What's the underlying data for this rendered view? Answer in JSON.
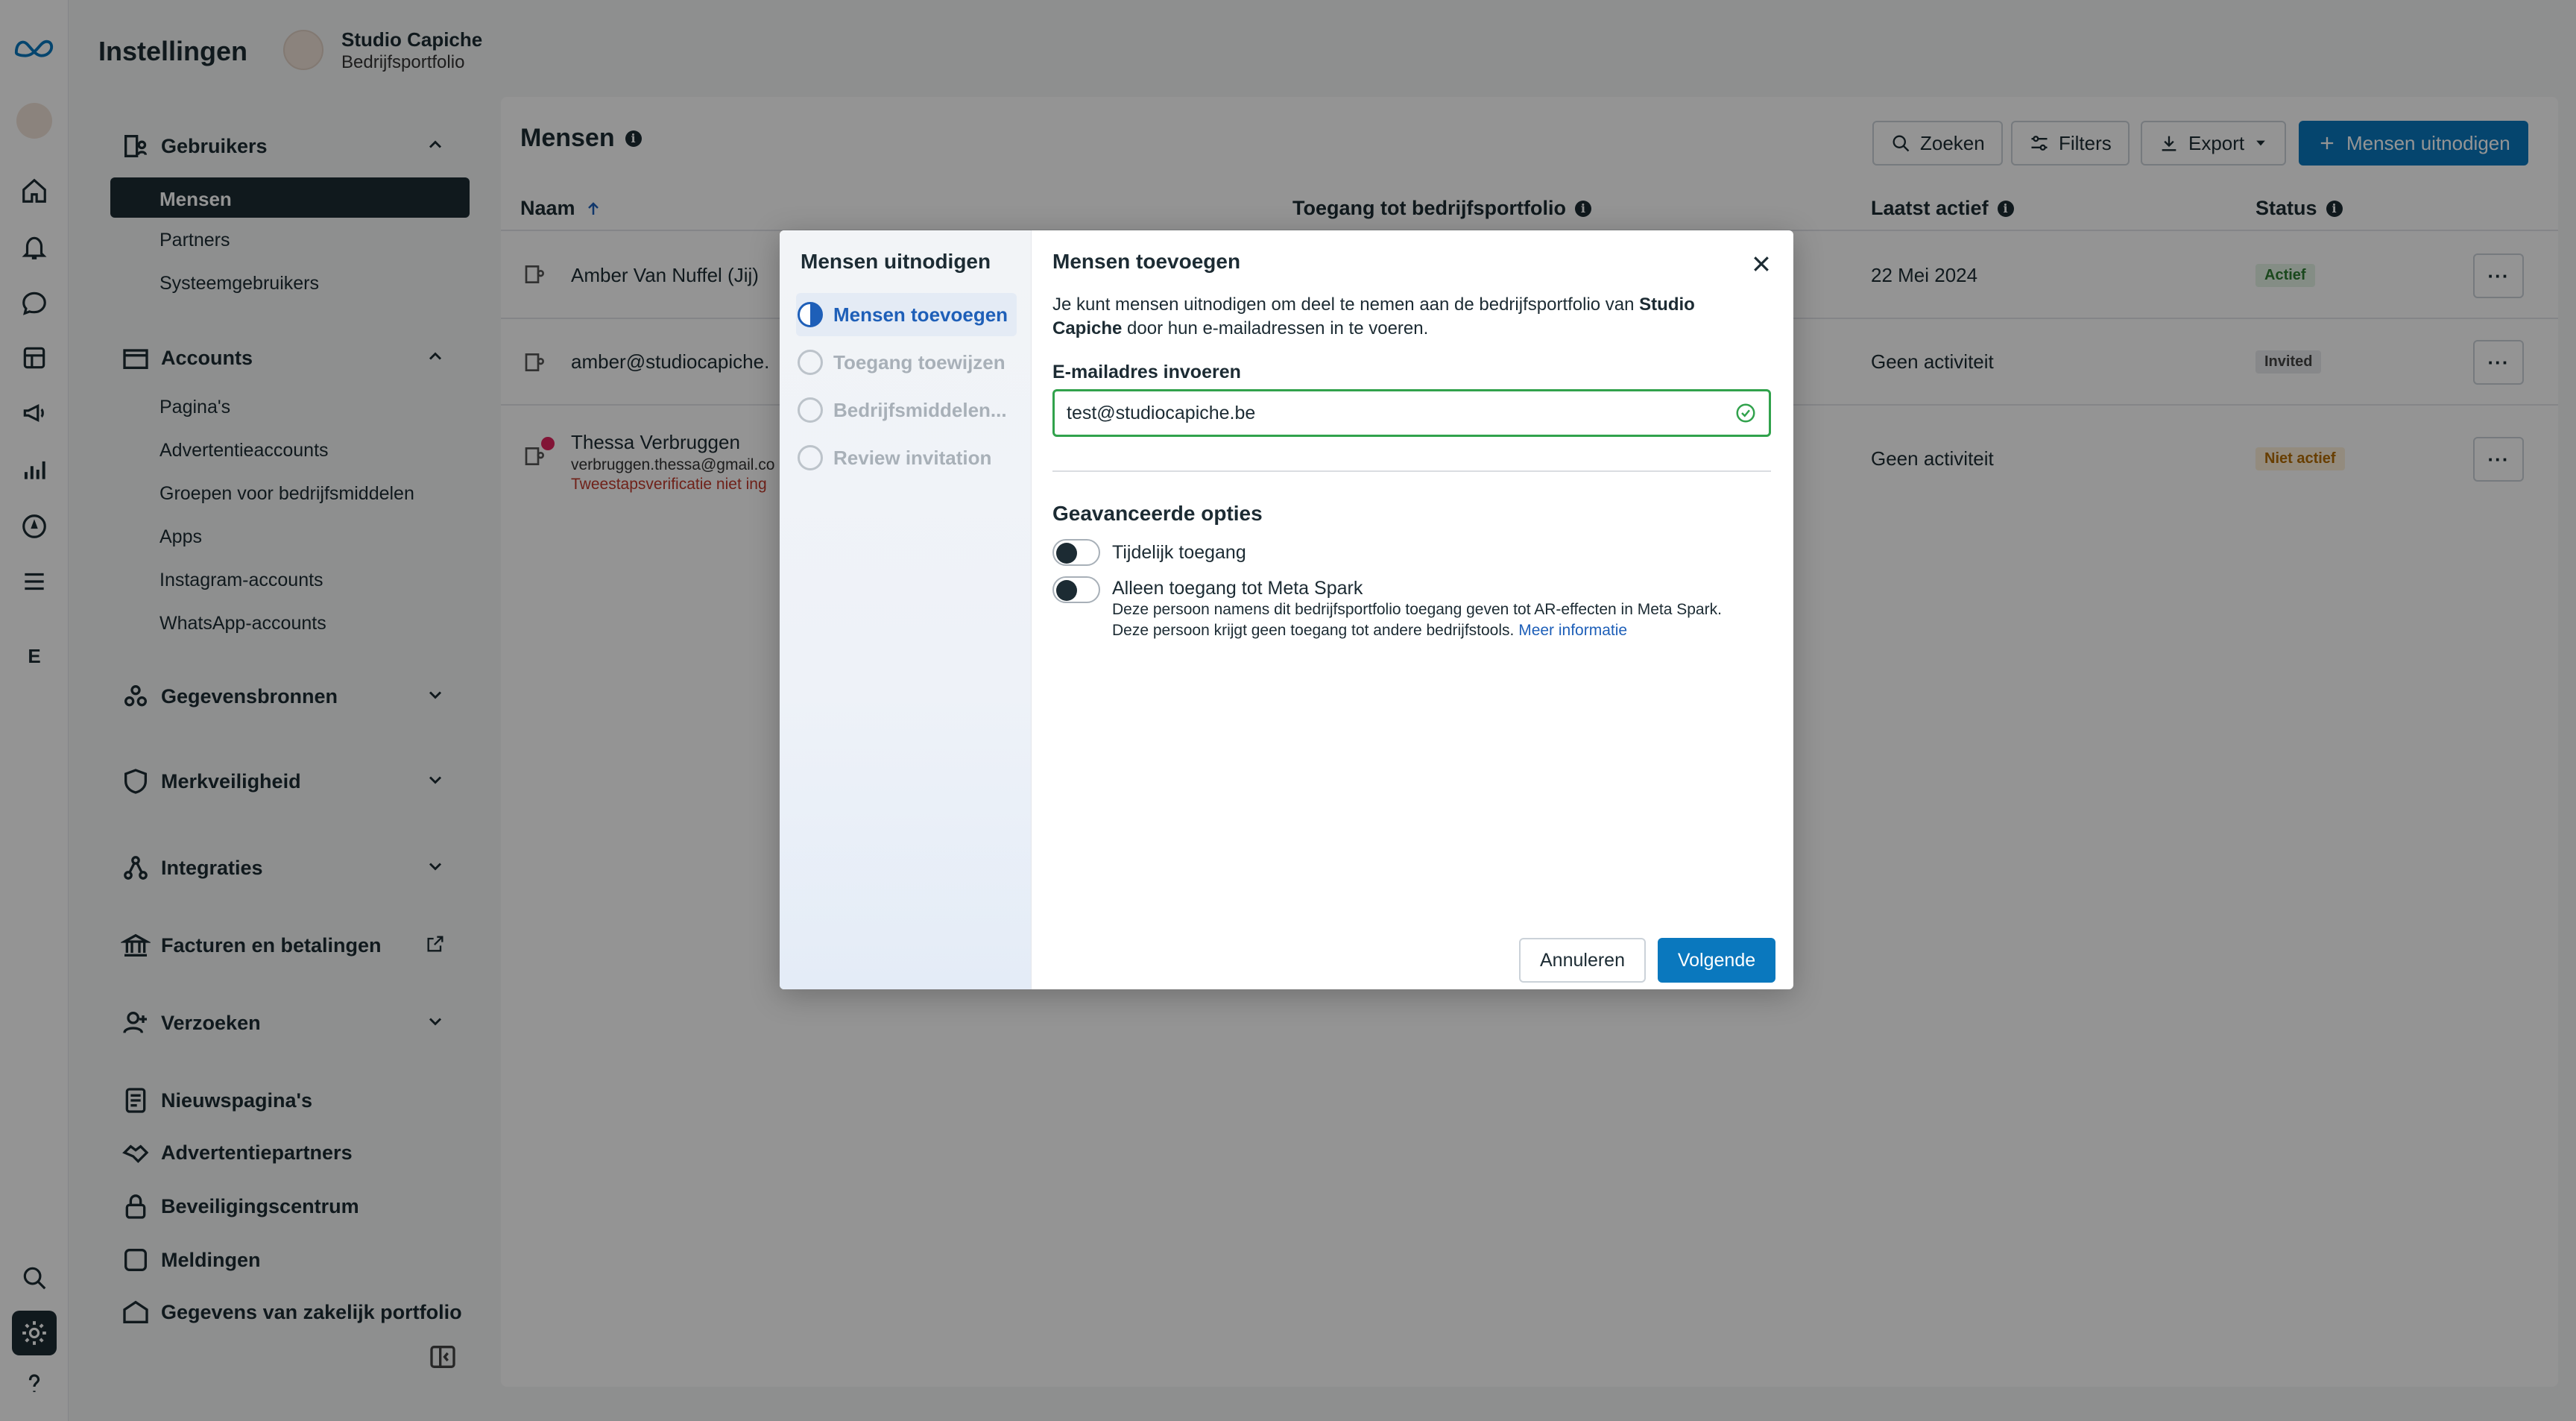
{
  "app": {
    "title": "Instellingen",
    "portfolio_name": "Studio Capiche",
    "portfolio_type": "Bedrijfsportfolio",
    "rail_letter": "E"
  },
  "sidebar": {
    "users_section": "Gebruikers",
    "users_items": [
      "Mensen",
      "Partners",
      "Systeemgebruikers"
    ],
    "accounts_section": "Accounts",
    "accounts_items": [
      "Pagina's",
      "Advertentieaccounts",
      "Groepen voor bedrijfsmiddelen",
      "Apps",
      "Instagram-accounts",
      "WhatsApp-accounts"
    ],
    "sections": [
      "Gegevensbronnen",
      "Merkveiligheid",
      "Integraties",
      "Facturen en betalingen",
      "Verzoeken",
      "Nieuwspagina's",
      "Advertentiepartners",
      "Beveiligingscentrum",
      "Meldingen",
      "Gegevens van zakelijk portfolio"
    ]
  },
  "main": {
    "title": "Mensen",
    "search_label": "Zoeken",
    "filters_label": "Filters",
    "export_label": "Export",
    "invite_label": "Mensen uitnodigen",
    "columns": {
      "name": "Naam",
      "access": "Toegang tot bedrijfsportfolio",
      "last_active": "Laatst actief",
      "status": "Status"
    },
    "rows": [
      {
        "name": "Amber Van Nuffel (Jij)",
        "last_active": "22 Mei 2024",
        "status": "Actief"
      },
      {
        "name": "amber@studiocapiche.",
        "last_active": "Geen activiteit",
        "status": "Invited"
      },
      {
        "name": "Thessa Verbruggen",
        "email": "verbruggen.thessa@gmail.co",
        "warning": "Tweestapsverificatie niet ing",
        "last_active": "Geen activiteit",
        "status": "Niet actief"
      }
    ],
    "more_label": "···"
  },
  "modal": {
    "left_title": "Mensen uitnodigen",
    "steps": [
      "Mensen toevoegen",
      "Toegang toewijzen",
      "Bedrijfsmiddelen...",
      "Review invitation"
    ],
    "title": "Mensen toevoegen",
    "desc_prefix": "Je kunt mensen uitnodigen om deel te nemen aan de bedrijfsportfolio van ",
    "desc_brand": "Studio Capiche",
    "desc_suffix": " door hun e-mailadressen in te voeren.",
    "email_label": "E-mailadres invoeren",
    "email_value": "test@studiocapiche.be",
    "advanced_title": "Geavanceerde opties",
    "option_temp": "Tijdelijk toegang",
    "option_spark": "Alleen toegang tot Meta Spark",
    "option_spark_desc1": "Deze persoon namens dit bedrijfsportfolio toegang geven tot AR-effecten in Meta Spark.",
    "option_spark_desc2": "Deze persoon krijgt geen toegang tot andere bedrijfstools.",
    "more_info": "Meer informatie",
    "cancel": "Annuleren",
    "next": "Volgende"
  },
  "colors": {
    "primary": "#0a78be",
    "success": "#31a24c",
    "active_badge_bg": "#e3f3e6",
    "invited_badge_bg": "#e9ebee",
    "inactive_badge_bg": "#fdf0d9"
  }
}
